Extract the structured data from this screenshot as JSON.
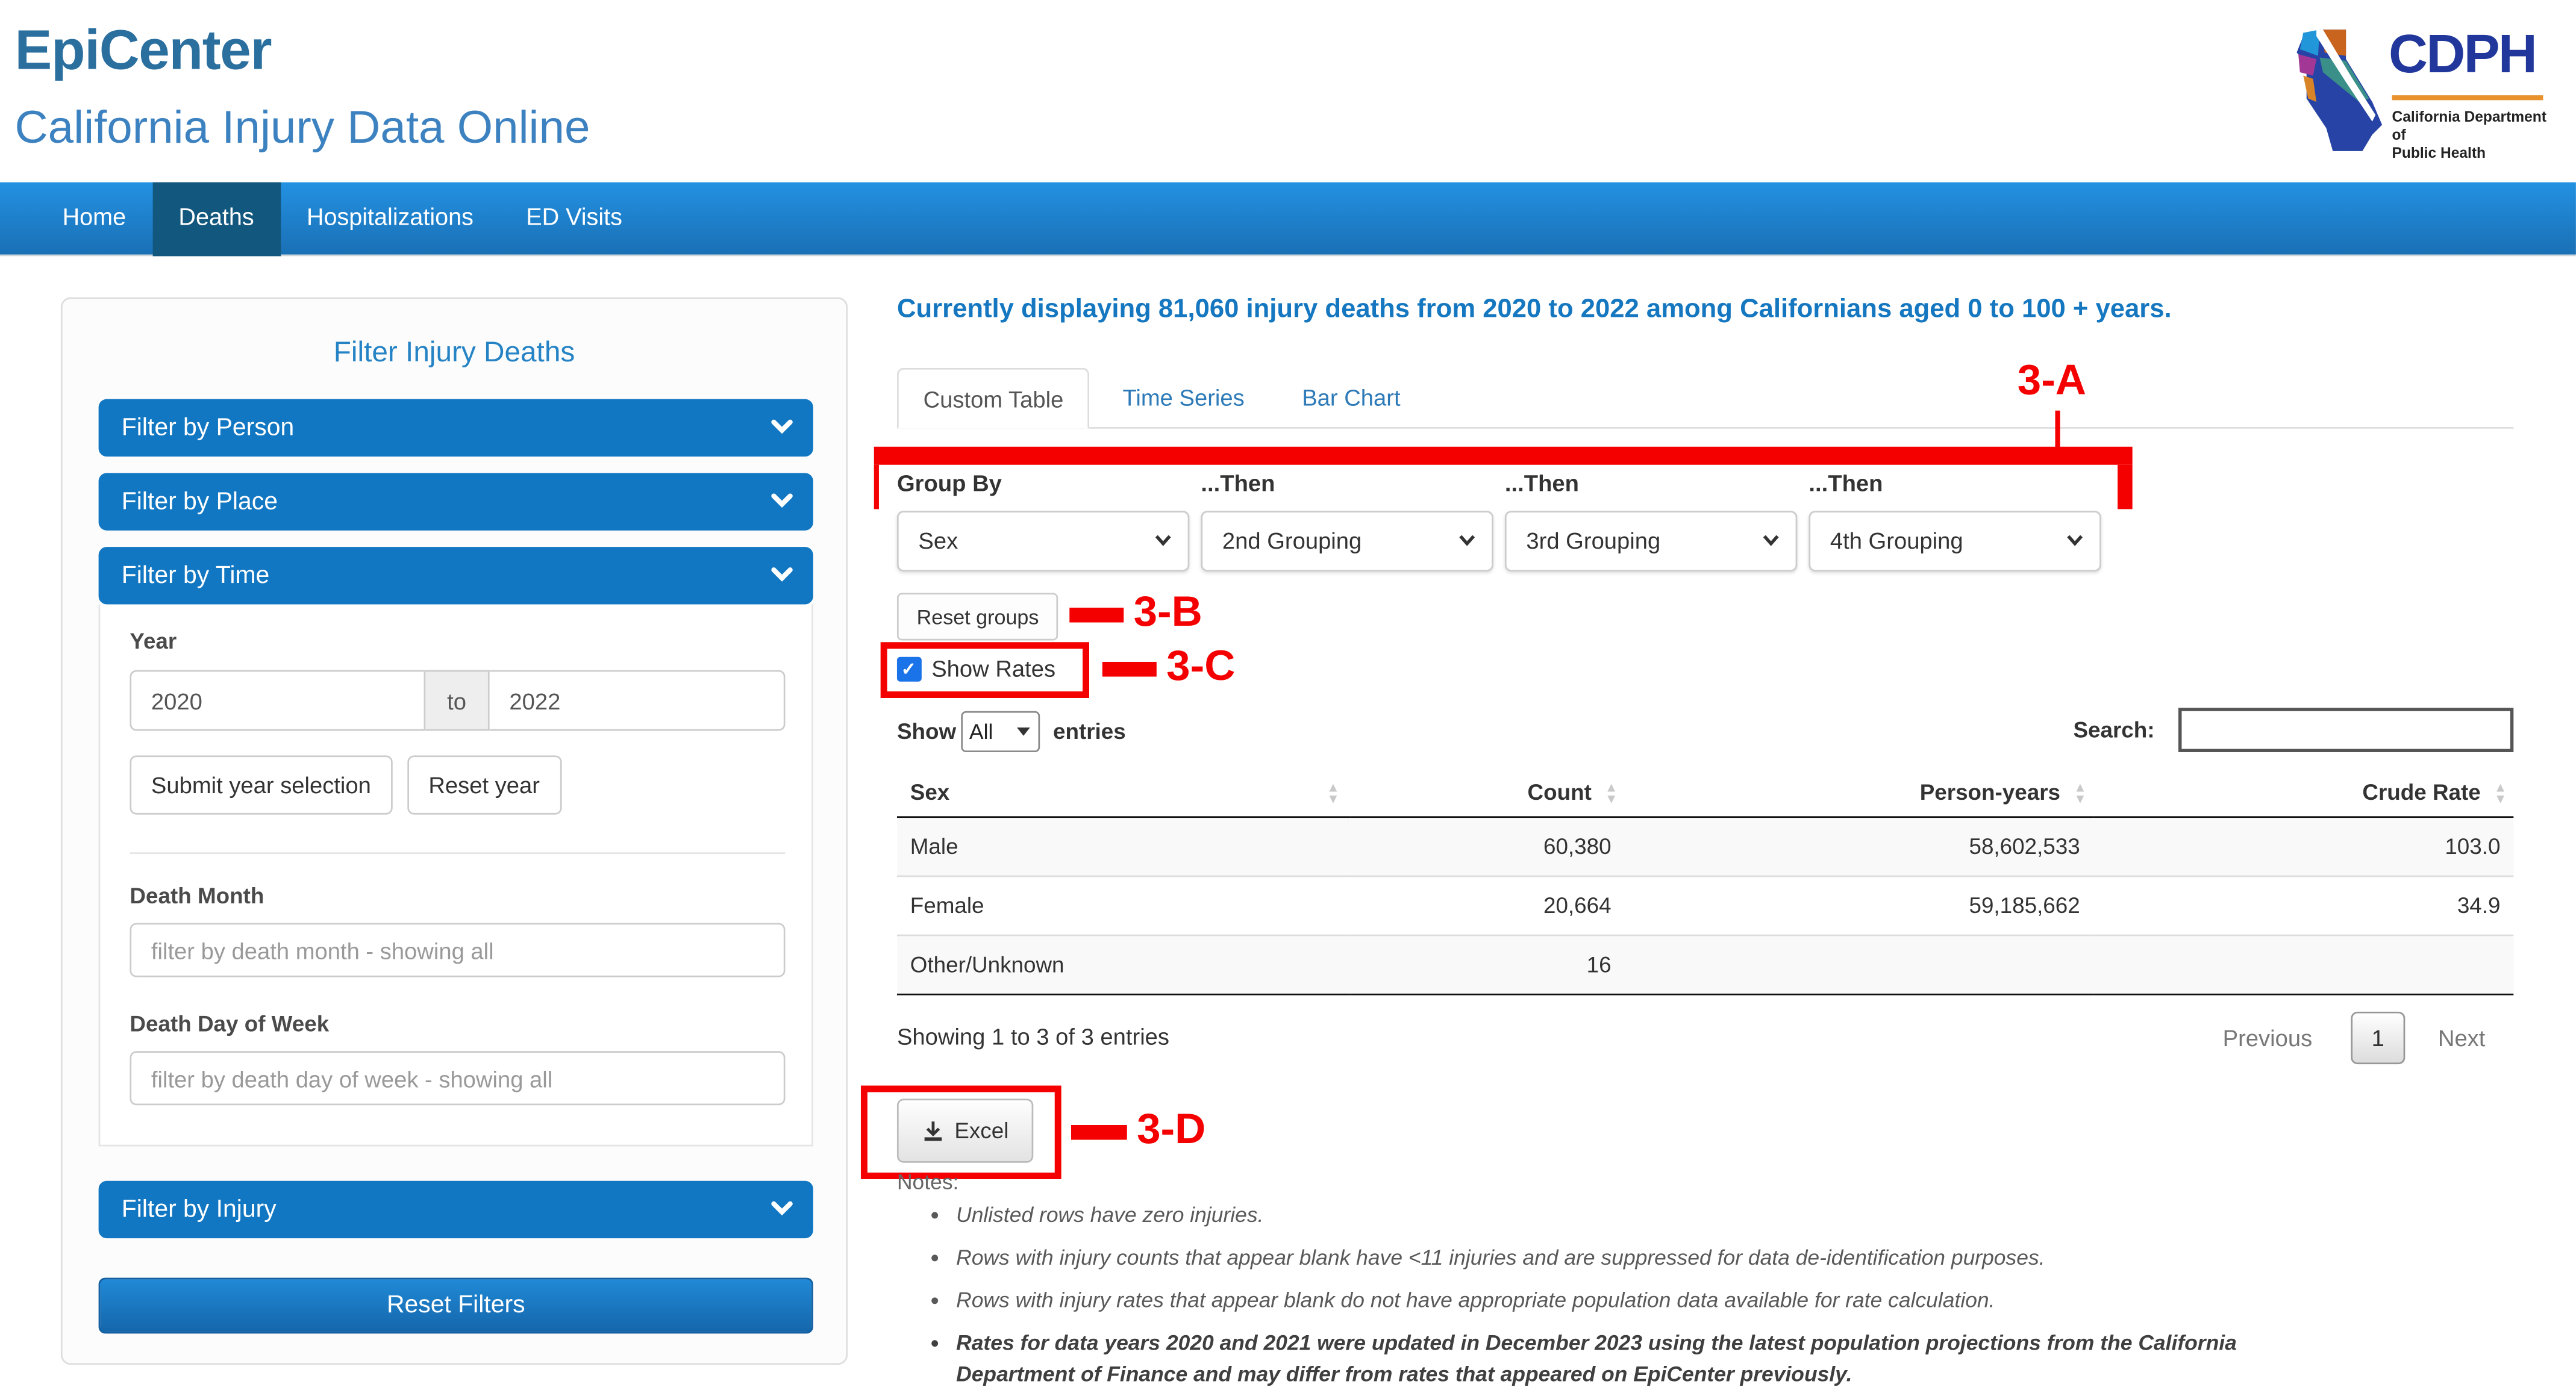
{
  "header": {
    "title": "EpiCenter",
    "subtitle": "California Injury Data Online",
    "logo": {
      "acronym": "CDPH",
      "dept_line1": "California Department of",
      "dept_line2": "Public Health"
    }
  },
  "nav": {
    "items": [
      {
        "label": "Home"
      },
      {
        "label": "Deaths"
      },
      {
        "label": "Hospitalizations"
      },
      {
        "label": "ED Visits"
      }
    ]
  },
  "sidebar": {
    "title": "Filter Injury Deaths",
    "accordion_person": "Filter by Person",
    "accordion_place": "Filter by Place",
    "accordion_time": "Filter by Time",
    "accordion_injury": "Filter by Injury",
    "time_panel": {
      "year_label": "Year",
      "year_from": "2020",
      "year_separator": "to",
      "year_to": "2022",
      "submit_button": "Submit year selection",
      "reset_button": "Reset year",
      "death_month_label": "Death Month",
      "death_month_placeholder": "filter by death month - showing all",
      "death_dow_label": "Death Day of Week",
      "death_dow_placeholder": "filter by death day of week - showing all"
    },
    "reset_filters_button": "Reset Filters"
  },
  "main": {
    "summary": "Currently displaying 81,060 injury deaths from 2020 to 2022 among Californians aged 0 to 100 + years.",
    "tabs": [
      {
        "label": "Custom Table",
        "active": true
      },
      {
        "label": "Time Series",
        "active": false
      },
      {
        "label": "Bar Chart",
        "active": false
      }
    ],
    "grouping": {
      "labels": [
        "Group By",
        "...Then",
        "...Then",
        "...Then"
      ],
      "selects": [
        "Sex",
        "2nd Grouping",
        "3rd Grouping",
        "4th Grouping"
      ],
      "reset_groups_button": "Reset groups",
      "show_rates_label": "Show Rates",
      "show_rates_checked": true
    },
    "controls": {
      "show_label": "Show",
      "entries_value": "All",
      "entries_label": "entries",
      "search_label": "Search:",
      "search_value": ""
    },
    "table": {
      "columns": [
        "Sex",
        "Count",
        "Person-years",
        "Crude Rate"
      ],
      "rows": [
        {
          "sex": "Male",
          "count": "60,380",
          "person_years": "58,602,533",
          "crude_rate": "103.0"
        },
        {
          "sex": "Female",
          "count": "20,664",
          "person_years": "59,185,662",
          "crude_rate": "34.9"
        },
        {
          "sex": "Other/Unknown",
          "count": "16",
          "person_years": "",
          "crude_rate": ""
        }
      ]
    },
    "table_footer": {
      "info": "Showing 1 to 3 of 3 entries",
      "previous": "Previous",
      "page": "1",
      "next": "Next"
    },
    "excel_button": "Excel",
    "notes_title": "Notes:",
    "notes": [
      "Unlisted rows have zero injuries.",
      "Rows with injury counts that appear blank have <11 injuries and are suppressed for data de-identification purposes.",
      "Rows with injury rates that appear blank do not have appropriate population data available for rate calculation.",
      "Rates for data years 2020 and 2021 were updated in December 2023 using the latest population projections from the California Department of Finance and may differ from rates that appeared on EpiCenter previously."
    ],
    "annotations": {
      "a": "3-A",
      "b": "3-B",
      "c": "3-C",
      "d": "3-D"
    }
  },
  "colors": {
    "accent_blue": "#1277c2",
    "nav_gradient_top": "#2391e2",
    "nav_gradient_bottom": "#1a70b5",
    "nav_active": "#12577d",
    "annotation_red": "#f40000",
    "link_blue": "#2d7ab8",
    "logo_navy": "#21379b",
    "logo_orange": "#e8912d"
  }
}
